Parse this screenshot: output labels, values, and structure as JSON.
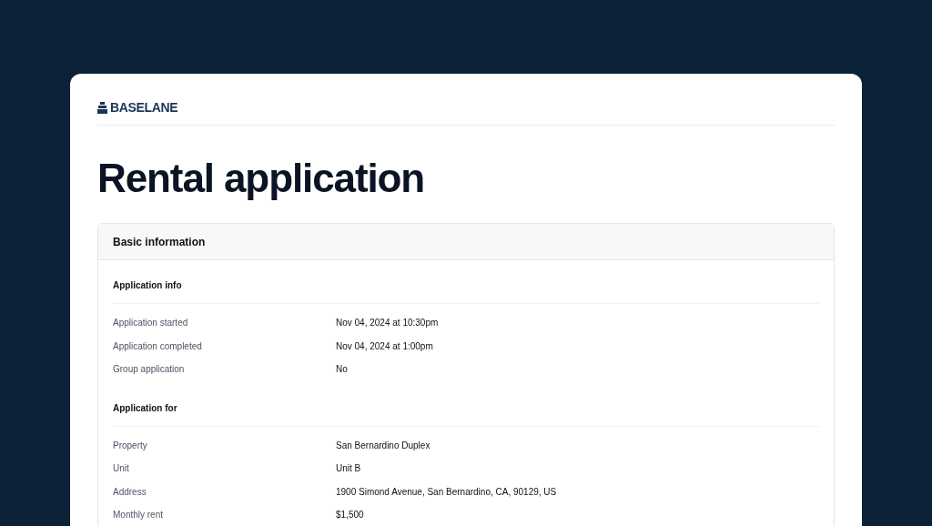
{
  "logo": {
    "text": "BASELANE"
  },
  "title": "Rental application",
  "section": {
    "title": "Basic information",
    "groups": [
      {
        "title": "Application info",
        "rows": [
          {
            "label": "Application started",
            "value": "Nov 04, 2024 at 10:30pm"
          },
          {
            "label": "Application completed",
            "value": "Nov 04, 2024 at 1:00pm"
          },
          {
            "label": "Group application",
            "value": "No"
          }
        ]
      },
      {
        "title": "Application for",
        "rows": [
          {
            "label": "Property",
            "value": "San Bernardino Duplex"
          },
          {
            "label": "Unit",
            "value": "Unit B"
          },
          {
            "label": "Address",
            "value": "1900 Simond Avenue, San Bernardino, CA, 90129, US"
          },
          {
            "label": "Monthly rent",
            "value": "$1,500"
          }
        ]
      }
    ]
  }
}
